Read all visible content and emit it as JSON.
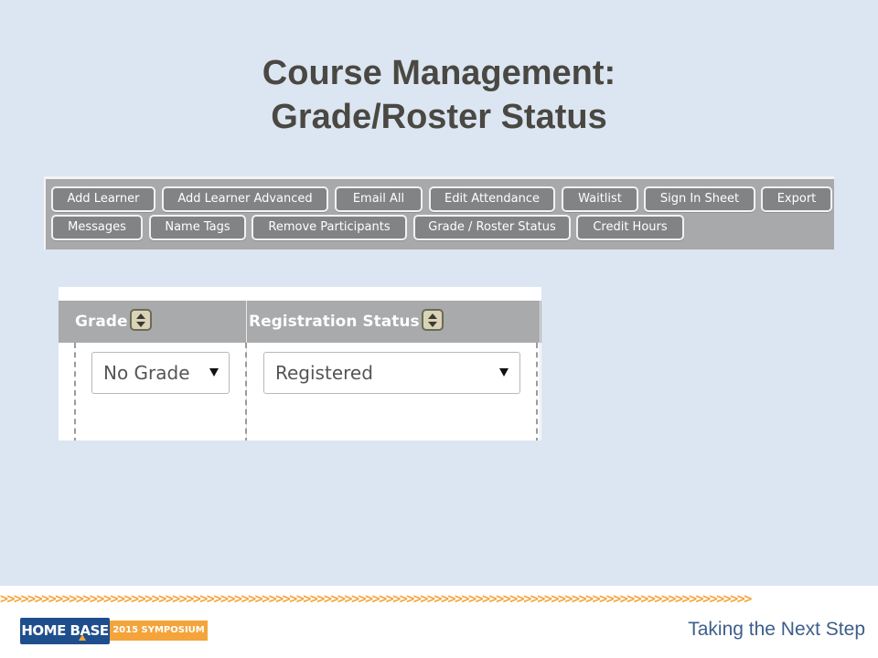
{
  "slide": {
    "title_line1": "Course Management:",
    "title_line2": "Grade/Roster Status"
  },
  "toolbar": {
    "row1": [
      "Add Learner",
      "Add Learner Advanced",
      "Email All",
      "Edit Attendance",
      "Waitlist",
      "Sign In Sheet",
      "Export"
    ],
    "row2": [
      "Messages",
      "Name Tags",
      "Remove Participants",
      "Grade / Roster Status",
      "Credit Hours"
    ]
  },
  "grid": {
    "columns": [
      {
        "header": "Grade",
        "sort_icon": "sort-updown-icon"
      },
      {
        "header": "Registration Status",
        "sort_icon": "sort-updown-icon"
      }
    ],
    "grade_select": {
      "value": "No Grade",
      "icon": "dropdown-arrow-icon"
    },
    "status_select": {
      "value": "Registered",
      "icon": "dropdown-arrow-icon"
    }
  },
  "footer": {
    "chevrons": ">>>>>>>>>>>>>>>>>>>>>>>>>>>>>>>>>>>>>>>>>>>>>>>>>>>>>>>>>>>>>>>>>>>>>>>>>>>>>>>>>>>>>>>>>>>>>>>>>>>>>>>>>>>>>",
    "logo_text": "HOME BASE",
    "logo_badge": "2015 SYMPOSIUM",
    "tagline": "Taking the Next Step"
  },
  "colors": {
    "background": "#dce6f2",
    "title": "#4a4842",
    "toolbar": "#a8a9ab",
    "button": "#828385",
    "accent_orange": "#f4a43a",
    "brand_blue": "#1f4e8c"
  }
}
